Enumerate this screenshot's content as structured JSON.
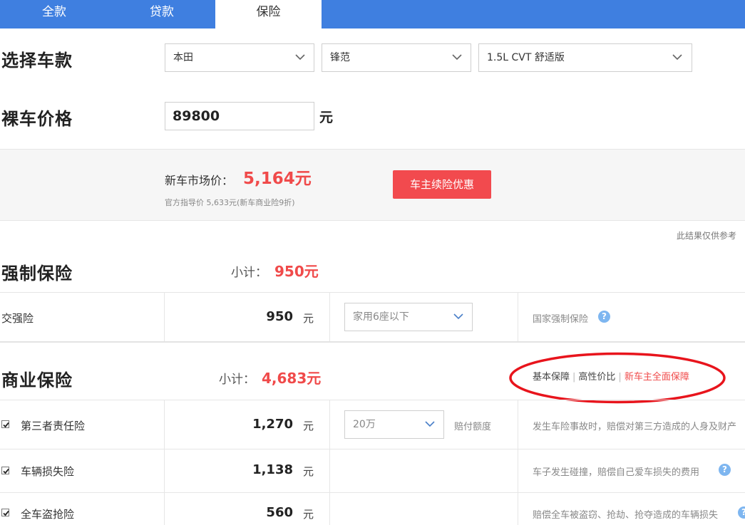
{
  "tabs": [
    "全款",
    "贷款",
    "保险"
  ],
  "select_car": {
    "title": "选择车款",
    "brand": "本田",
    "model": "锋范",
    "variant": "1.5L CVT 舒适版"
  },
  "bare_price": {
    "title": "裸车价格",
    "value": "89800",
    "unit": "元"
  },
  "summary": {
    "market_label": "新车市场价：",
    "market_value": "5,164元",
    "guide_note": "官方指导价 5,633元(新车商业险9折)",
    "promo_button": "车主续险优惠",
    "disclaimer": "此结果仅供参考"
  },
  "compulsory": {
    "title": "强制保险",
    "subtotal_label": "小计：",
    "subtotal_value": "950元",
    "item": {
      "name": "交强险",
      "amount": "950",
      "unit": "元",
      "option": "家用6座以下",
      "desc": "国家强制保险"
    }
  },
  "commercial": {
    "title": "商业保险",
    "subtotal_label": "小计：",
    "subtotal_value": "4,683元",
    "plans": [
      "基本保障",
      "高性价比",
      "新车主全面保障"
    ],
    "separator": "|",
    "items": [
      {
        "name": "第三者责任险",
        "amount": "1,270",
        "unit": "元",
        "option": "20万",
        "option_label": "赔付额度",
        "desc": "发生车险事故时，赔偿对第三方造成的人身及财产"
      },
      {
        "name": "车辆损失险",
        "amount": "1,138",
        "unit": "元",
        "desc": "车子发生碰撞，赔偿自己爱车损失的费用"
      },
      {
        "name": "全车盗抢险",
        "amount": "560",
        "unit": "元",
        "desc": "赔偿全车被盗窃、抢劫、抢夺造成的车辆损失"
      }
    ]
  },
  "help_glyph": "?",
  "colors": {
    "tab_blue": "#3f7fe0",
    "accent_red": "#f04a4a",
    "button_red": "#f24a4e",
    "help_blue": "#7eb6f0",
    "highlight_ellipse": "#e8141c"
  }
}
